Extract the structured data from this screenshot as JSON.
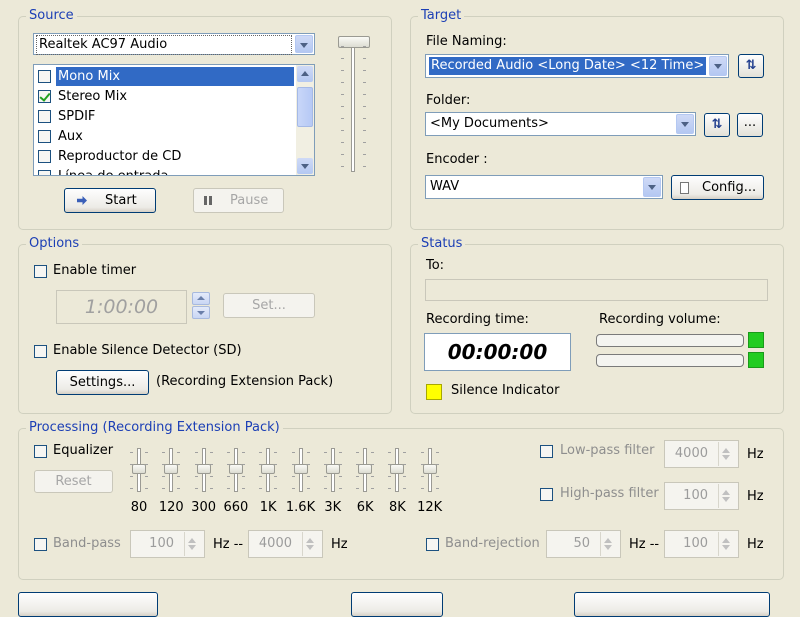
{
  "source": {
    "title": "Source",
    "device": "Realtek AC97 Audio",
    "inputs": [
      {
        "label": "Mono Mix",
        "checked": false,
        "selected": true
      },
      {
        "label": "Stereo Mix",
        "checked": true,
        "selected": false
      },
      {
        "label": "SPDIF",
        "checked": false,
        "selected": false
      },
      {
        "label": "Aux",
        "checked": false,
        "selected": false
      },
      {
        "label": "Reproductor de CD",
        "checked": false,
        "selected": false
      },
      {
        "label": "Línea de entrada",
        "checked": false,
        "selected": false
      }
    ],
    "start_label": "Start",
    "pause_label": "Pause"
  },
  "target": {
    "title": "Target",
    "file_naming_label": "File Naming:",
    "file_naming_value": "Recorded Audio <Long Date> <12 Time>",
    "folder_label": "Folder:",
    "folder_value": "<My Documents>",
    "browse_label": "...",
    "encoder_label": "Encoder :",
    "encoder_value": "WAV",
    "config_label": "Config..."
  },
  "options": {
    "title": "Options",
    "enable_timer_label": "Enable timer",
    "timer_value": "1:00:00",
    "set_label": "Set...",
    "silence_detector_label": "Enable Silence Detector (SD)",
    "settings_label": "Settings...",
    "extension_note": "(Recording Extension Pack)"
  },
  "status": {
    "title": "Status",
    "to_label": "To:",
    "to_value": "",
    "recording_time_label": "Recording time:",
    "recording_time_value": "00:00:00",
    "recording_volume_label": "Recording volume:",
    "silence_indicator_label": "Silence Indicator",
    "colors": {
      "volume_led": "#22cc22",
      "silence_led": "#ffff00"
    }
  },
  "processing": {
    "title": "Processing (Recording Extension Pack)",
    "equalizer_label": "Equalizer",
    "reset_label": "Reset",
    "eq_bands": [
      "80",
      "120",
      "300",
      "660",
      "1K",
      "1.6K",
      "3K",
      "6K",
      "8K",
      "12K"
    ],
    "lowpass_label": "Low-pass filter",
    "lowpass_value": "4000",
    "highpass_label": "High-pass filter",
    "highpass_value": "100",
    "hz": "Hz",
    "hz_dash": "Hz --",
    "bandpass_label": "Band-pass",
    "bandpass_from": "100",
    "bandpass_to": "4000",
    "bandrejection_label": "Band-rejection",
    "bandrejection_from": "50",
    "bandrejection_to": "100"
  }
}
